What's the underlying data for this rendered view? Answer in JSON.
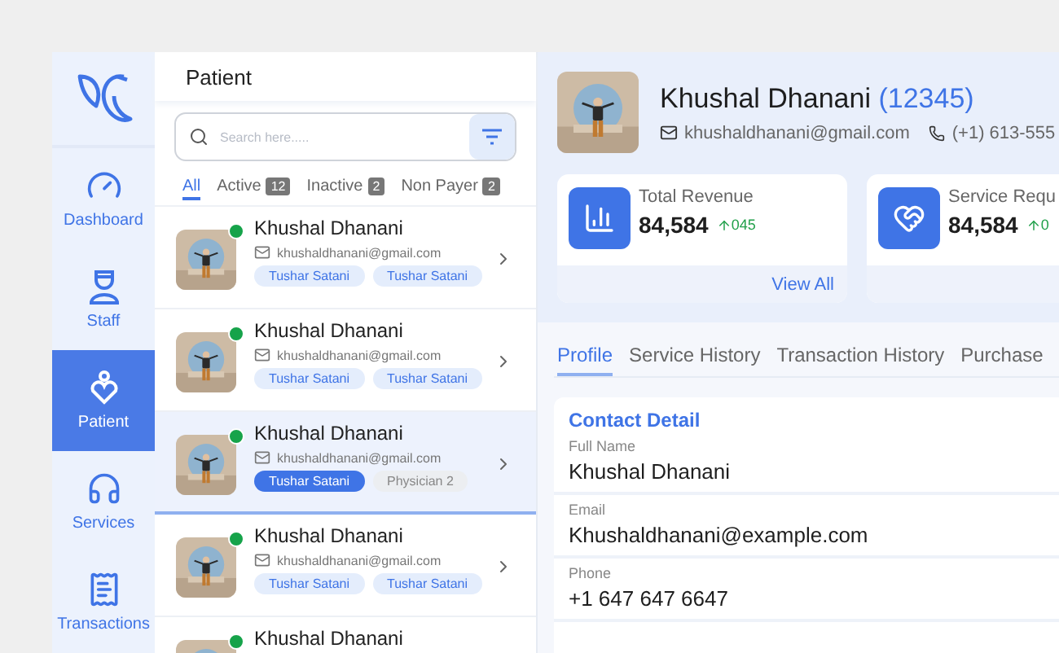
{
  "sidebar": {
    "items": [
      {
        "label": "Dashboard",
        "kind": "dashboard",
        "selected": false
      },
      {
        "label": "Staff",
        "kind": "staff",
        "selected": false
      },
      {
        "label": "Patient",
        "kind": "patient",
        "selected": true
      },
      {
        "label": "Services",
        "kind": "services",
        "selected": false
      },
      {
        "label": "Transactions",
        "kind": "transactions",
        "selected": false
      }
    ]
  },
  "patient_list": {
    "title": "Patient",
    "search": {
      "placeholder": "Search here....."
    },
    "filters": [
      {
        "label": "All",
        "selected": true
      },
      {
        "label": "Active",
        "count": "12",
        "selected": false
      },
      {
        "label": "Inactive",
        "count": "2",
        "selected": false
      },
      {
        "label": "Non Payer",
        "count": "2",
        "selected": false
      }
    ],
    "rows": [
      {
        "name": "Khushal Dhanani",
        "email": "khushaldhanani@gmail.com",
        "online": true,
        "selected": false,
        "tags": [
          {
            "label": "Tushar Satani",
            "kind": "light"
          },
          {
            "label": "Tushar Satani",
            "kind": "light"
          }
        ]
      },
      {
        "name": "Khushal Dhanani",
        "email": "khushaldhanani@gmail.com",
        "online": true,
        "selected": false,
        "tags": [
          {
            "label": "Tushar Satani",
            "kind": "light"
          },
          {
            "label": "Tushar Satani",
            "kind": "light"
          }
        ]
      },
      {
        "name": "Khushal Dhanani",
        "email": "khushaldhanani@gmail.com",
        "online": true,
        "selected": true,
        "tags": [
          {
            "label": "Tushar Satani",
            "kind": "filled"
          },
          {
            "label": "Physician 2",
            "kind": "gray"
          }
        ]
      },
      {
        "name": "Khushal Dhanani",
        "email": "khushaldhanani@gmail.com",
        "online": true,
        "selected": false,
        "tags": [
          {
            "label": "Tushar Satani",
            "kind": "light"
          },
          {
            "label": "Tushar Satani",
            "kind": "light"
          }
        ]
      },
      {
        "name": "Khushal Dhanani",
        "online": true,
        "selected": false
      }
    ]
  },
  "profile": {
    "name": "Khushal Dhanani",
    "id": "(12345)",
    "email": "khushaldhanani@gmail.com",
    "phone": "(+1) 613-555",
    "stats": [
      {
        "title": "Total Revenue",
        "value": "84,584",
        "change": "045",
        "kind": "revenue",
        "link": "View All"
      },
      {
        "title": "Service Requ",
        "value": "84,584",
        "change": "0",
        "kind": "service"
      }
    ],
    "tabs": [
      {
        "label": "Profile",
        "selected": true
      },
      {
        "label": "Service History",
        "selected": false
      },
      {
        "label": "Transaction History",
        "selected": false
      },
      {
        "label": "Purchase",
        "selected": false
      }
    ],
    "contact": {
      "title": "Contact Detail",
      "fields": [
        {
          "label": "Full Name",
          "value": "Khushal Dhanani"
        },
        {
          "label": "Email",
          "value": "Khushaldhanani@example.com"
        },
        {
          "label": "Phone",
          "value": "+1 647 647 6647"
        }
      ]
    }
  }
}
